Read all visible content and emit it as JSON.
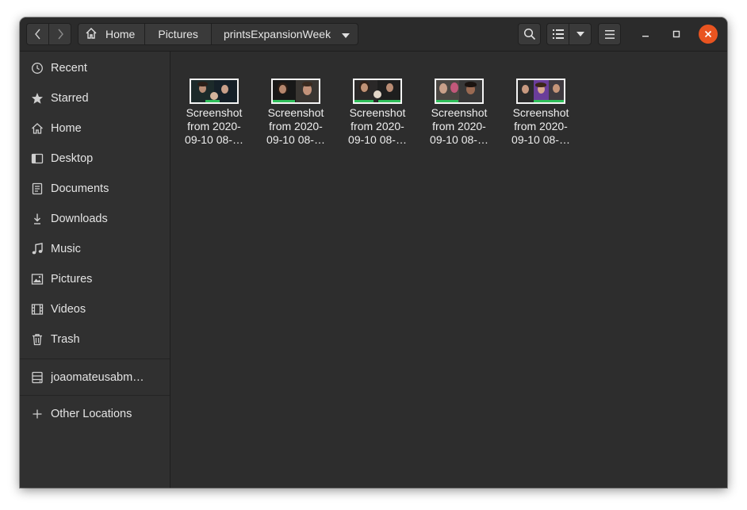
{
  "header": {
    "breadcrumbs": [
      "Home",
      "Pictures",
      "printsExpansionWeek"
    ]
  },
  "sidebar": {
    "items": [
      {
        "label": "Recent",
        "icon": "clock-icon"
      },
      {
        "label": "Starred",
        "icon": "star-icon"
      },
      {
        "label": "Home",
        "icon": "home-icon"
      },
      {
        "label": "Desktop",
        "icon": "desktop-icon"
      },
      {
        "label": "Documents",
        "icon": "document-icon"
      },
      {
        "label": "Downloads",
        "icon": "download-icon"
      },
      {
        "label": "Music",
        "icon": "music-icon"
      },
      {
        "label": "Pictures",
        "icon": "picture-icon"
      },
      {
        "label": "Videos",
        "icon": "film-icon"
      },
      {
        "label": "Trash",
        "icon": "trash-icon"
      }
    ],
    "network_drive": {
      "label": "joaomateusabm…",
      "icon": "network-drive-icon"
    },
    "other_locations": {
      "label": "Other Locations",
      "icon": "plus-icon"
    }
  },
  "files": [
    {
      "line1": "Screenshot",
      "line2": "from 2020-",
      "line3": "09-10 08-…"
    },
    {
      "line1": "Screenshot",
      "line2": "from 2020-",
      "line3": "09-10 08-…"
    },
    {
      "line1": "Screenshot",
      "line2": "from 2020-",
      "line3": "09-10 08-…"
    },
    {
      "line1": "Screenshot",
      "line2": "from 2020-",
      "line3": "09-10 08-…"
    },
    {
      "line1": "Screenshot",
      "line2": "from 2020-",
      "line3": "09-10 08-…"
    }
  ],
  "colors": {
    "accent_close": "#e95420",
    "window_bg": "#2d2d2d",
    "sidebar_bg": "#303030"
  }
}
